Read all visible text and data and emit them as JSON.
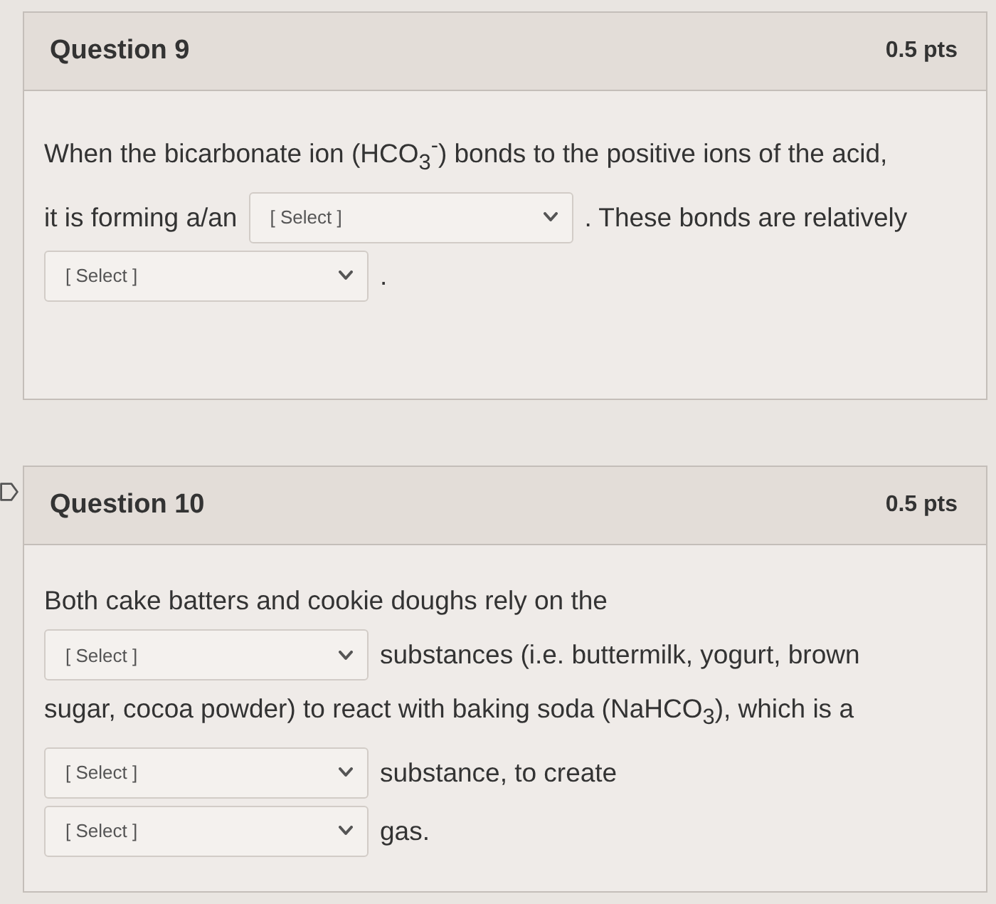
{
  "questions": [
    {
      "title": "Question 9",
      "points": "0.5 pts",
      "marked": false,
      "lines": [
        [
          {
            "kind": "text",
            "text": "When the bicarbonate ion (HCO$_{3}$$^{-}$) bonds to the positive ions of the acid,"
          }
        ],
        [
          {
            "kind": "text",
            "text": "it is forming a/an"
          },
          {
            "kind": "select",
            "placeholder": "[ Select ]"
          },
          {
            "kind": "text",
            "text": ". These bonds are relatively"
          }
        ],
        [
          {
            "kind": "select",
            "placeholder": "[ Select ]"
          },
          {
            "kind": "text",
            "text": "."
          }
        ]
      ]
    },
    {
      "title": "Question 10",
      "points": "0.5 pts",
      "marked": true,
      "lines": [
        [
          {
            "kind": "text",
            "text": "Both cake batters and cookie doughs rely on the"
          }
        ],
        [
          {
            "kind": "select",
            "placeholder": "[ Select ]"
          },
          {
            "kind": "text",
            "text": "substances (i.e. buttermilk, yogurt, brown"
          }
        ],
        [
          {
            "kind": "text",
            "text": "sugar, cocoa powder) to react with baking soda (NaHCO$_{3}$), which is a"
          }
        ],
        [
          {
            "kind": "select",
            "placeholder": "[ Select ]"
          },
          {
            "kind": "text",
            "text": "substance, to create"
          }
        ],
        [
          {
            "kind": "select",
            "placeholder": "[ Select ]"
          },
          {
            "kind": "text",
            "text": "gas."
          }
        ]
      ]
    }
  ]
}
